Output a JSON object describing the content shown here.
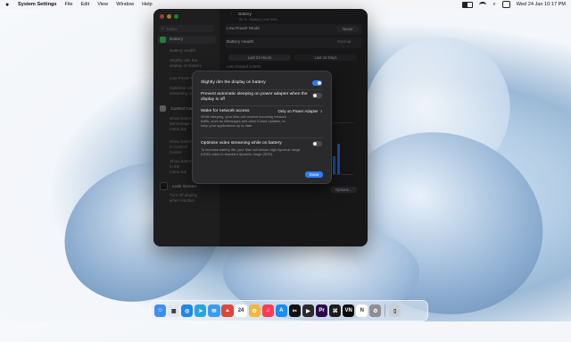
{
  "menubar": {
    "app_name": "System Settings",
    "items": [
      "File",
      "Edit",
      "View",
      "Window",
      "Help"
    ],
    "clock": "Wed 24 Jan  10:17 PM"
  },
  "sidebar": {
    "search_placeholder": "batter",
    "items": [
      {
        "label": "Battery",
        "icon": "battery-icon",
        "color": "#34c759",
        "selected": true
      },
      {
        "label": "Control Centre",
        "icon": "control-centre-icon",
        "color": "#8e8e93"
      },
      {
        "label": "Lock Screen",
        "icon": "lock-icon",
        "color": "#2c2c2e"
      }
    ],
    "sub_battery": [
      "Battery Health",
      "Slightly dim the",
      "display on battery",
      "Low Power Mode",
      "Optimise video",
      "streaming while on"
    ],
    "sub_control": [
      "Show battery",
      "percentage in the",
      "menu bar",
      "Show battery",
      "in Control",
      "Centre",
      "Show battery",
      "in the",
      "menu bar"
    ],
    "sub_lock": [
      "Turn off display",
      "when inactive"
    ]
  },
  "main": {
    "title": "Battery",
    "subtitle": "80 % · Battery Level 80%",
    "low_power_label": "Low Power Mode",
    "low_power_value": "Never",
    "health_label": "Battery Health",
    "health_value": "Normal",
    "last_charged": "Last charged to 80%",
    "tabs": [
      "Last 24 Hours",
      "Last 10 Days"
    ],
    "options_button": "Options..."
  },
  "sheet": {
    "options": [
      {
        "title": "Slightly dim the display on battery",
        "toggle": true
      },
      {
        "title": "Prevent automatic sleeping on power adapter when the display is off",
        "toggle": false
      },
      {
        "title": "Wake for network access",
        "desc": "While sleeping, your Mac can receive incoming network traffic, such as iMessages and other iCloud updates, to keep your applications up to date.",
        "select": "Only on Power Adapter"
      },
      {
        "title": "Optimise video streaming while on battery",
        "desc": "To increase battery life, your Mac will stream high dynamic range (HDR) video in standard dynamic range (SDR).",
        "toggle": false
      }
    ],
    "done_label": "Done"
  },
  "dock": [
    {
      "name": "finder-icon",
      "color": "#3d8ff2",
      "glyph": "☺"
    },
    {
      "name": "launchpad-icon",
      "color": "#e2e6ee",
      "glyph": "▦"
    },
    {
      "name": "safari-icon",
      "color": "#1e88e5",
      "glyph": "◎"
    },
    {
      "name": "telegram-icon",
      "color": "#2aa3e0",
      "glyph": "➤"
    },
    {
      "name": "mail-icon",
      "color": "#3a9bf0",
      "glyph": "✉"
    },
    {
      "name": "app-store-shopping-icon",
      "color": "#d94a3c",
      "glyph": "▲"
    },
    {
      "name": "calendar-icon",
      "color": "#ffffff",
      "glyph": "24"
    },
    {
      "name": "photos-icon",
      "color": "#f2b83b",
      "glyph": "✿"
    },
    {
      "name": "music-icon",
      "color": "#fa3d55",
      "glyph": "♫"
    },
    {
      "name": "app-store-icon",
      "color": "#1b8bf5",
      "glyph": "A"
    },
    {
      "name": "capcut-icon",
      "color": "#111111",
      "glyph": "✂"
    },
    {
      "name": "final-cut-icon",
      "color": "#2b2b2b",
      "glyph": "▶"
    },
    {
      "name": "premiere-icon",
      "color": "#2a0a4a",
      "glyph": "Pr"
    },
    {
      "name": "capcut-alt-icon",
      "color": "#1c1c1c",
      "glyph": "⌘"
    },
    {
      "name": "vn-editor-icon",
      "color": "#0b0b0b",
      "glyph": "VN"
    },
    {
      "name": "notion-icon",
      "color": "#ffffff",
      "glyph": "N"
    },
    {
      "name": "system-settings-icon",
      "color": "#8e8e93",
      "glyph": "⚙"
    },
    {
      "name": "trash-icon",
      "color": "#c9ced6",
      "glyph": "▯"
    }
  ]
}
